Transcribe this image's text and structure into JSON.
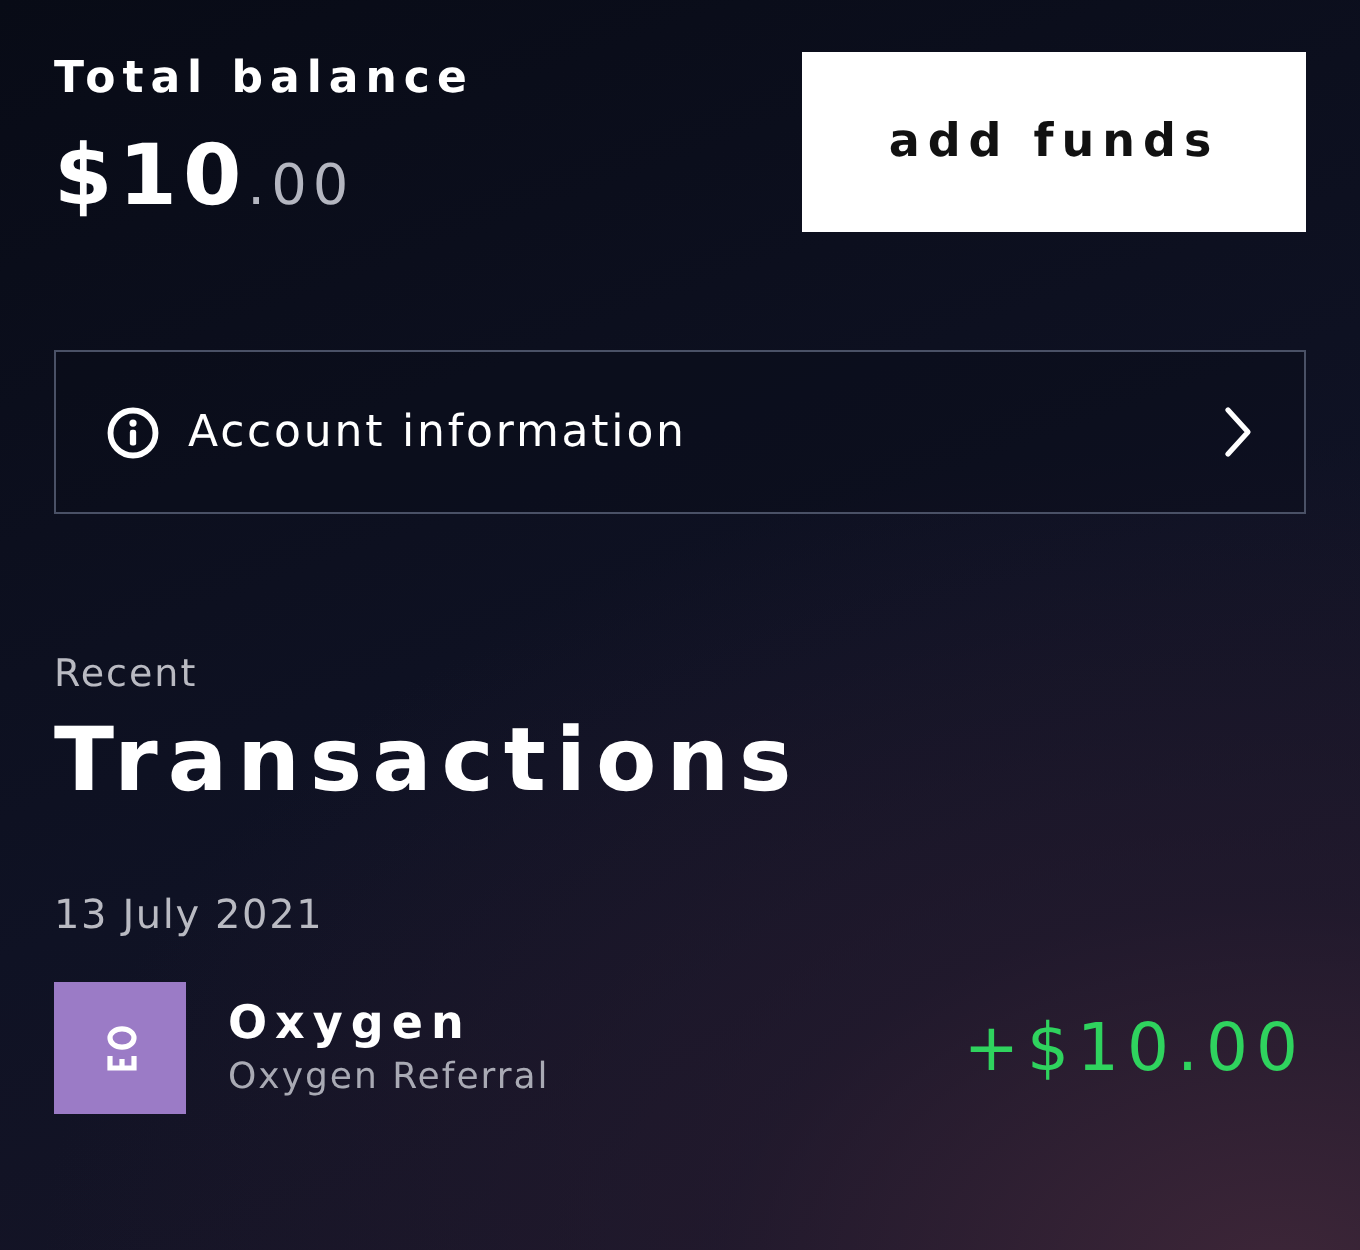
{
  "balance": {
    "label": "Total balance",
    "whole": "$10",
    "cents": ".00"
  },
  "add_funds_button": {
    "label": "add funds"
  },
  "account_link": {
    "label": "Account information"
  },
  "recent": {
    "label": "Recent",
    "title": "Transactions"
  },
  "transaction_groups": [
    {
      "date": "13 July 2021",
      "transactions": [
        {
          "title": "Oxygen",
          "subtitle": "Oxygen Referral",
          "amount": "+$10.00",
          "kind": "credit"
        }
      ]
    }
  ]
}
